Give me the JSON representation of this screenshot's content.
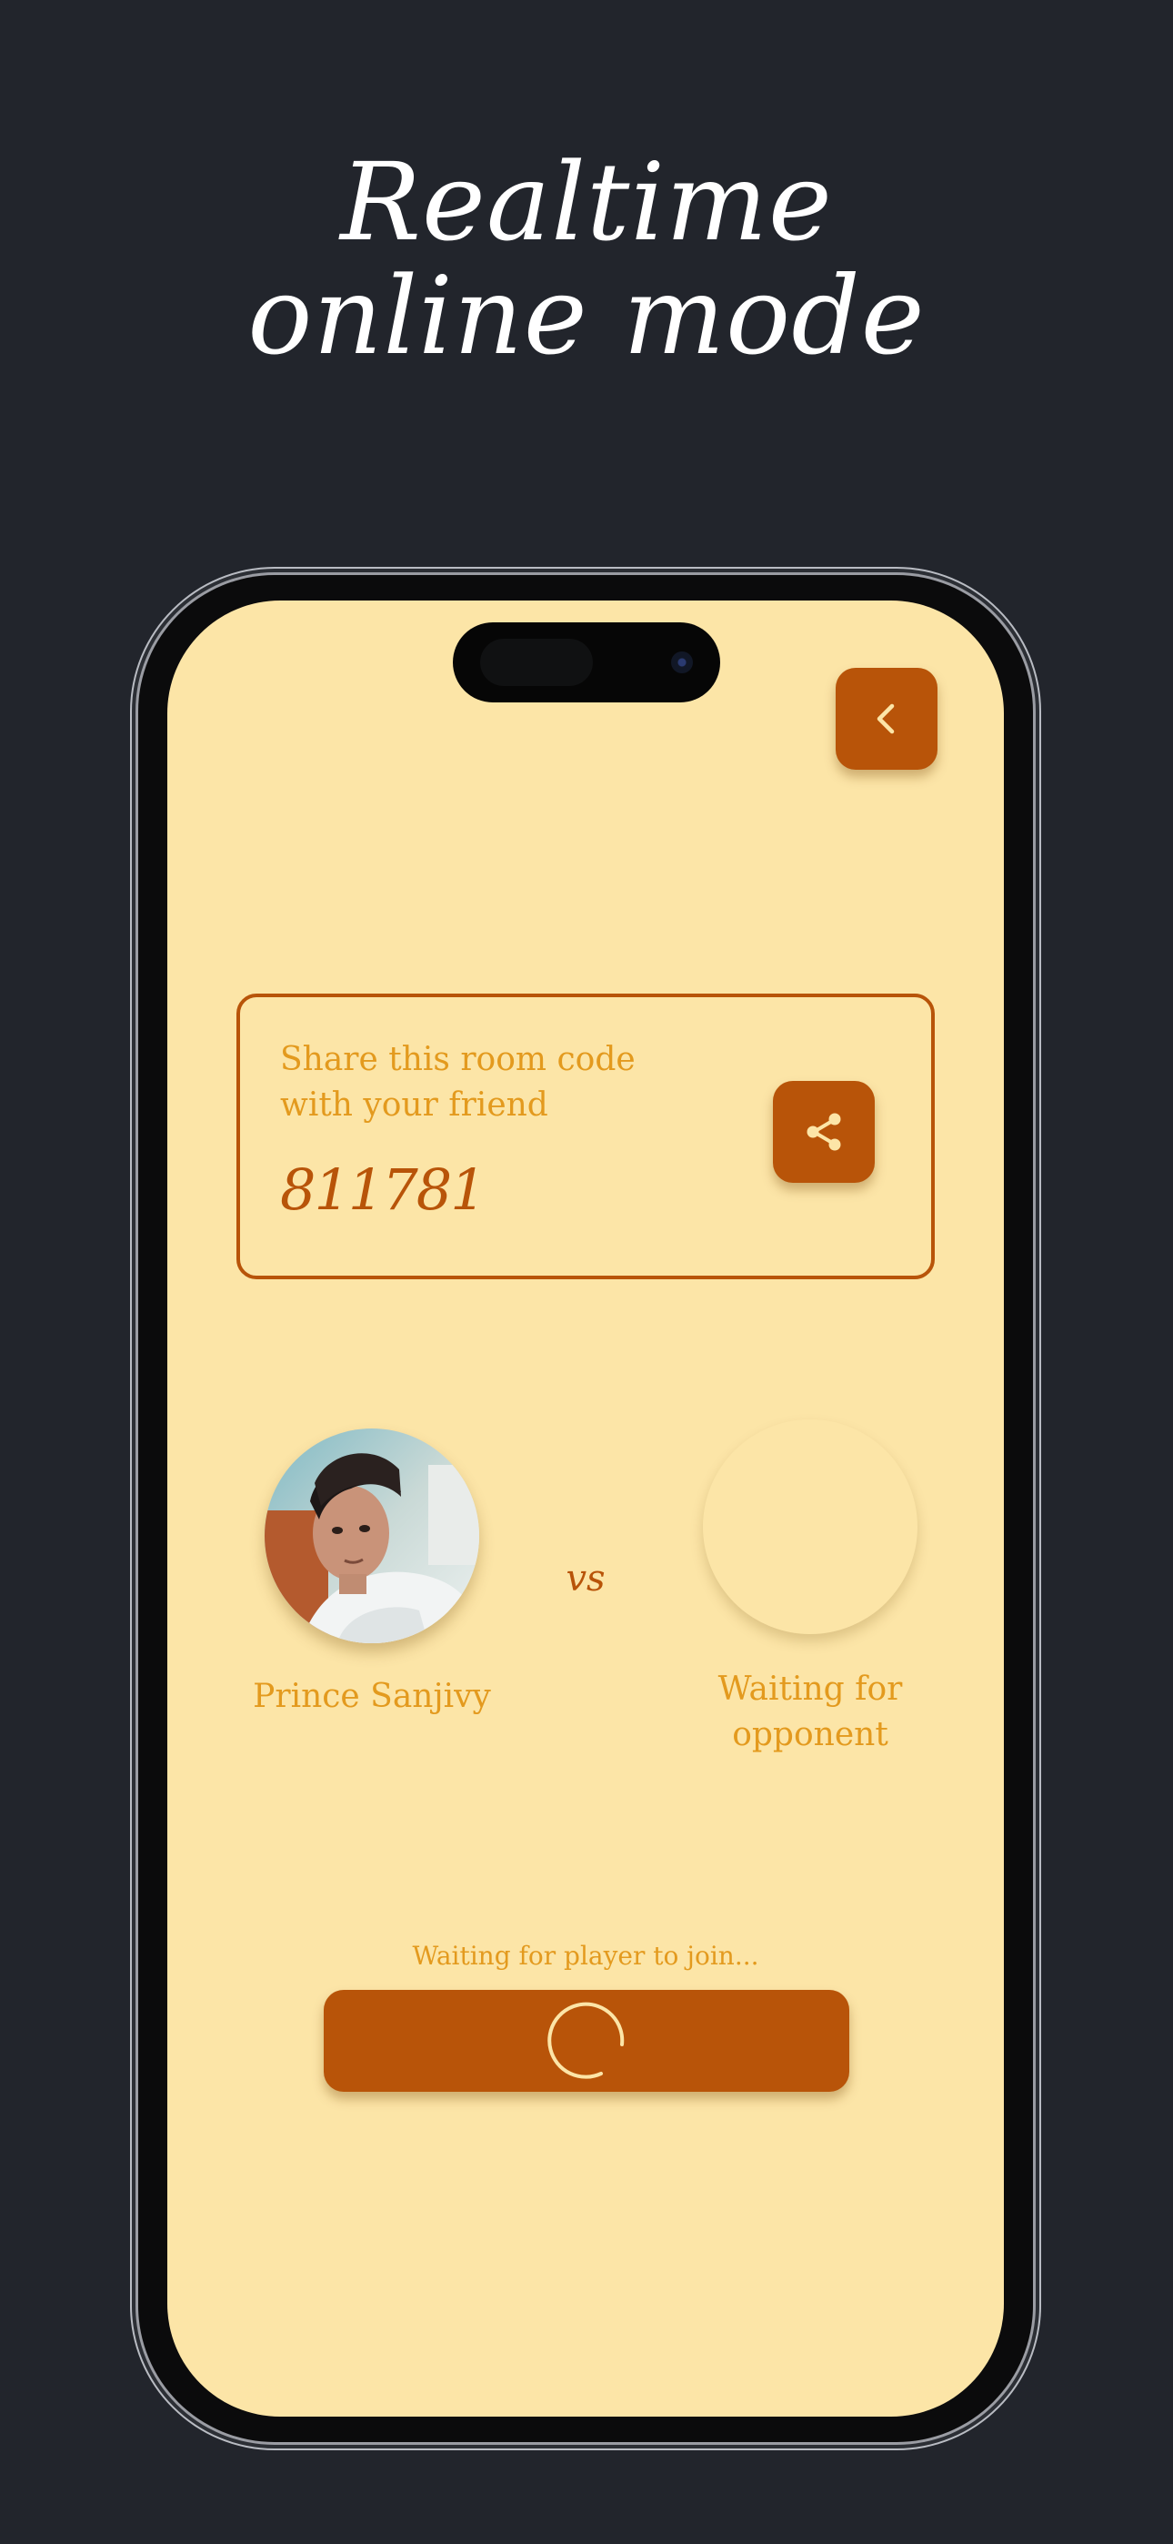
{
  "headline": {
    "line1": "Realtime",
    "line2": "online mode"
  },
  "colors": {
    "background": "#22252c",
    "screen": "#fce5a7",
    "accent": "#b85409",
    "text_light": "#e39a1e"
  },
  "header": {
    "back_icon": "chevron-left-icon"
  },
  "room": {
    "prompt_line1": "Share this room code",
    "prompt_line2": "with your friend",
    "code": "811781",
    "share_icon": "share-icon"
  },
  "match": {
    "player_name": "Prince Sanjivy",
    "vs": "vs",
    "opponent_line1": "Waiting for",
    "opponent_line2": "opponent"
  },
  "footer": {
    "status": "Waiting for player to join...",
    "spinner_icon": "loading-spinner-icon"
  }
}
